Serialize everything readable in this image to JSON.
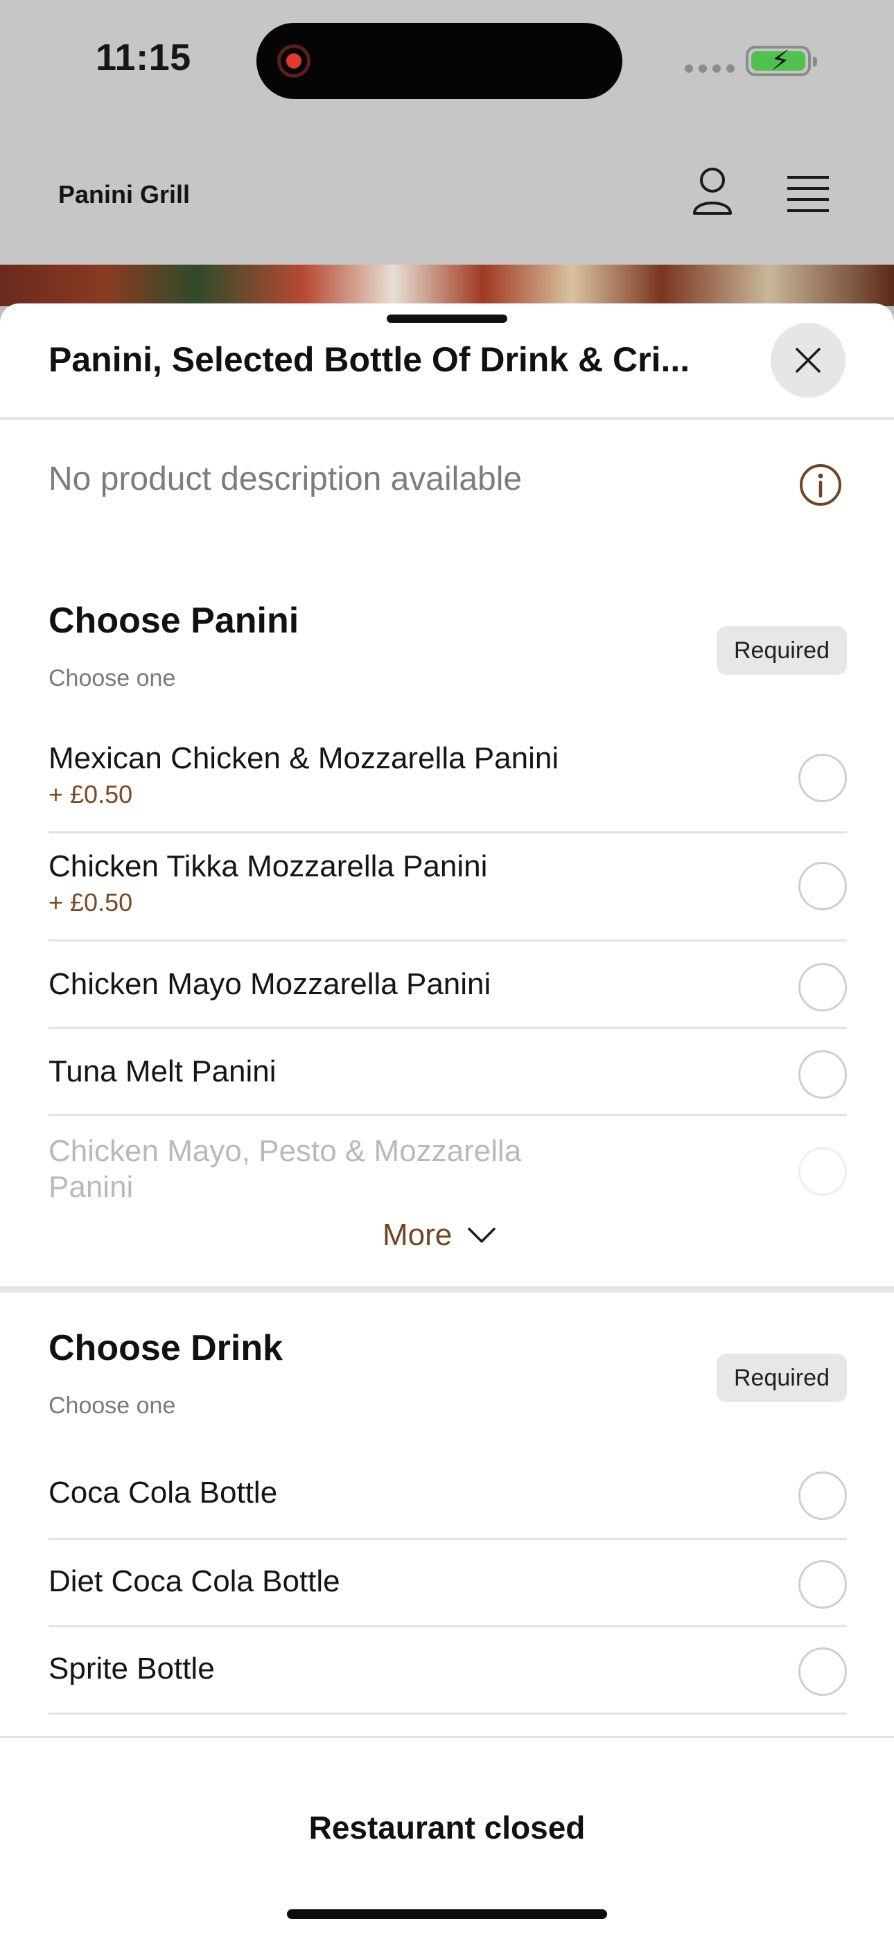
{
  "status_bar": {
    "time": "11:15"
  },
  "header": {
    "brand": "Panini Grill"
  },
  "sheet": {
    "title": "Panini, Selected Bottle Of Drink & Cri...",
    "description": "No product description available"
  },
  "sections": [
    {
      "title": "Choose Panini",
      "subtitle": "Choose one",
      "badge": "Required",
      "options": [
        {
          "label": "Mexican Chicken & Mozzarella Panini",
          "price": "+ £0.50"
        },
        {
          "label": "Chicken Tikka Mozzarella Panini",
          "price": "+ £0.50"
        },
        {
          "label": "Chicken Mayo Mozzarella Panini"
        },
        {
          "label": "Tuna Melt Panini"
        },
        {
          "label": "Chicken Mayo, Pesto & Mozzarella Panini"
        }
      ],
      "more_label": "More"
    },
    {
      "title": "Choose Drink",
      "subtitle": "Choose one",
      "badge": "Required",
      "options": [
        {
          "label": "Coca Cola Bottle"
        },
        {
          "label": "Diet Coca Cola Bottle"
        },
        {
          "label": "Sprite Bottle"
        }
      ]
    }
  ],
  "footer": {
    "status": "Restaurant closed"
  },
  "colors": {
    "accent_brown": "#7b4a22",
    "sheet_bg": "#ffffff",
    "dim_bg": "#c6c6c6"
  },
  "icons": [
    "record-icon",
    "battery-icon",
    "user-icon",
    "menu-icon",
    "close-icon",
    "info-icon",
    "chevron-down-icon"
  ]
}
